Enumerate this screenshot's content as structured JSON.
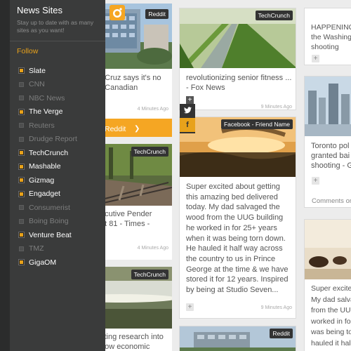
{
  "panel": {
    "title": "News Sites",
    "subtitle": "Stay up to date with as many sites as you want!",
    "follow_label": "Follow",
    "sites": [
      {
        "name": "Slate",
        "checked": true
      },
      {
        "name": "CNN",
        "checked": false
      },
      {
        "name": "NBC News",
        "checked": false
      },
      {
        "name": "The Verge",
        "checked": true
      },
      {
        "name": "Reuters",
        "checked": false
      },
      {
        "name": "Drudge Report",
        "checked": false
      },
      {
        "name": "TechCrunch",
        "checked": true
      },
      {
        "name": "Mashable",
        "checked": true
      },
      {
        "name": "Gizmag",
        "checked": true
      },
      {
        "name": "Engadget",
        "checked": true
      },
      {
        "name": "Consumerist",
        "checked": false
      },
      {
        "name": "Boing Boing",
        "checked": false
      },
      {
        "name": "Venture Beat",
        "checked": true
      },
      {
        "name": "TMZ",
        "checked": false
      },
      {
        "name": "GigaOM",
        "checked": true
      }
    ]
  },
  "cards": {
    "c1": {
      "tag": "Reddit",
      "headline": "d Cruz says it's no\np Canadian",
      "time": "4 Minutes Ago",
      "action": "Reddit"
    },
    "c2": {
      "tag": "TechCrunch",
      "headline": "ecutive Pender\nat 81 - Times -",
      "time": "4 Minutes Ago"
    },
    "c3": {
      "tag": "TechCrunch",
      "headline": "sting research into\nhow economic"
    },
    "c4": {
      "tag": "TechCrunch",
      "headline": "revolutionizing senior fitness ...\n- Fox News",
      "time": "9 Minutes Ago"
    },
    "c5": {
      "tag": "Facebook - Friend Name",
      "body": "Super excited about getting this amazing bed delivered today. My dad salvaged the wood from the UUG building he worked in for 25+ years when it was being torn down. He hauled it half way across the country to us in Prince George at the time & we have stored it for 12 years. Inspired by being at Studio Seven...",
      "time": "9 Minutes Ago"
    },
    "c6": {
      "tag": "Reddit"
    },
    "c7": {
      "headline": "HAPPENING\nthe Washing\nshooting"
    },
    "c8": {
      "headline": "Toronto pol\ngranted bai\nshooting - G",
      "comments": "Comments on"
    },
    "c9": {
      "body": "Super excite\nMy dad salva\nfrom the UUG\nworked in fo\nwas being to\nhauled it hal"
    }
  },
  "colors": {
    "accent": "#f5a623",
    "panel_bg": "#3a3b3b",
    "tag_bg": "#333333"
  },
  "icons": {
    "logo": "reddit-alien-icon",
    "twitter": "twitter-icon",
    "facebook": "facebook-icon",
    "plus": "plus-icon",
    "arrow": "chevron-right-icon"
  }
}
